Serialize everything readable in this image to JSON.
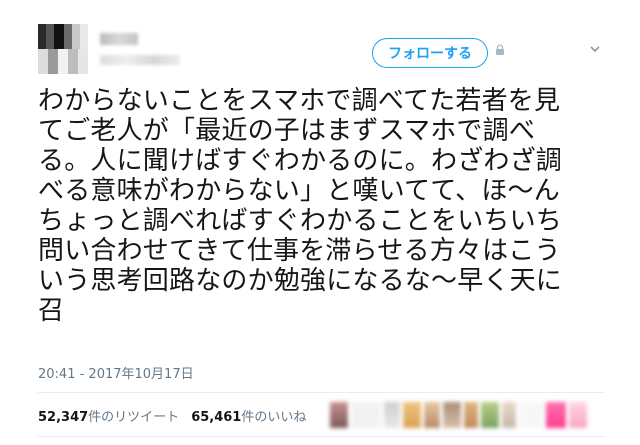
{
  "header": {
    "follow_label": "フォローする"
  },
  "tweet": {
    "text": "わからないことをスマホで調べてた若者を見\nてご老人が「最近の子はまずスマホで調べ\nる。人に聞けばすぐわかるのに。わざわざ調\nべる意味がわからない」と嘆いてて、ほ〜ん\nちょっと調べればすぐわかることをいちいち\n問い合わせてきて仕事を滞らせる方々はこう\nいう思考回路なのか勉強になるな〜早く天に\n召",
    "timestamp": "20:41 - 2017年10月17日"
  },
  "stats": {
    "retweets_count": "52,347",
    "retweets_label": "件のリツイート",
    "likes_count": "65,461",
    "likes_label": "件のいいね"
  },
  "colors": {
    "accent": "#1da1f2",
    "secondary_text": "#657786",
    "divider": "#e6ecf0"
  },
  "icons": {
    "header_small": "lock-icon",
    "caret": "chevron-down-icon"
  }
}
